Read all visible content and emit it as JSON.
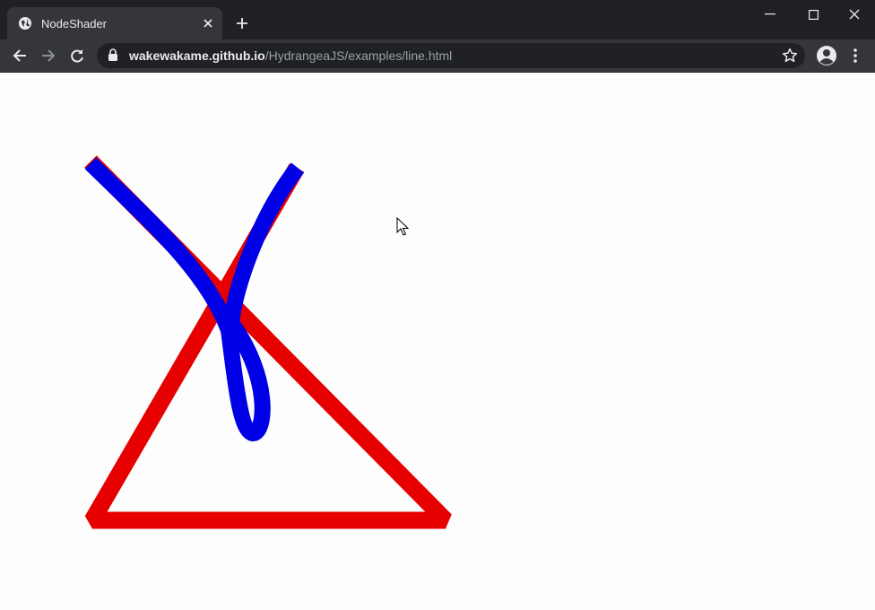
{
  "browser": {
    "tab_title": "NodeShader",
    "url_host": "wakewakame.github.io",
    "url_path": "/HydrangeaJS/examples/line.html"
  },
  "colors": {
    "triangle": "#e60000",
    "curve": "#0000e6",
    "chrome_dark": "#202124",
    "chrome_mid": "#35363a"
  },
  "icons": {
    "favicon": "globe-icon",
    "tab_close": "close-icon",
    "new_tab": "plus-icon",
    "back": "arrow-left-icon",
    "forward": "arrow-right-icon",
    "reload": "reload-icon",
    "lock": "lock-icon",
    "bookmark": "star-icon",
    "profile": "account-icon",
    "menu": "kebab-menu-icon"
  }
}
